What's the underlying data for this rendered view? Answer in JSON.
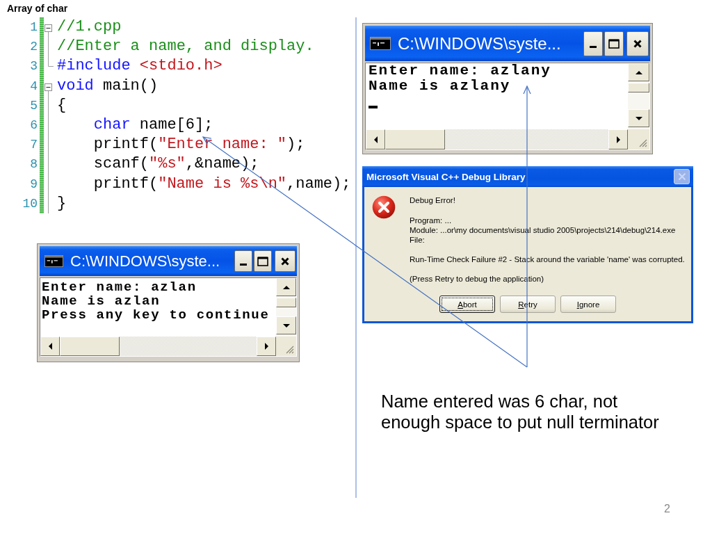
{
  "slide": {
    "title": "Array of char",
    "page_number": "2"
  },
  "left": {
    "code": {
      "lines": [
        {
          "number": "1",
          "kind": "start",
          "indented": false,
          "tokens": [
            {
              "kind": "comment",
              "text": "//1.cpp"
            }
          ]
        },
        {
          "number": "2",
          "kind": "middle",
          "indented": false,
          "tokens": [
            {
              "kind": "comment",
              "text": "//Enter a name, and display."
            }
          ]
        },
        {
          "number": "3",
          "kind": "end",
          "indented": false,
          "tokens": [
            {
              "kind": "keyword",
              "text": "#include "
            },
            {
              "kind": "string",
              "text": "<stdio.h>"
            }
          ]
        },
        {
          "number": "4",
          "kind": "start",
          "indented": false,
          "tokens": [
            {
              "kind": "keyword",
              "text": "void "
            },
            {
              "kind": "plain",
              "text": "main()"
            }
          ]
        },
        {
          "number": "5",
          "kind": "middle",
          "indented": false,
          "tokens": [
            {
              "kind": "plain",
              "text": "{"
            }
          ]
        },
        {
          "number": "6",
          "kind": "middle",
          "indented": true,
          "tokens": [
            {
              "kind": "keyword",
              "text": "char "
            },
            {
              "kind": "plain",
              "text": "name[6];"
            }
          ]
        },
        {
          "number": "7",
          "kind": "middle",
          "indented": true,
          "tokens": [
            {
              "kind": "plain",
              "text": "printf("
            },
            {
              "kind": "string",
              "text": "\"Enter name: \""
            },
            {
              "kind": "plain",
              "text": ");"
            }
          ]
        },
        {
          "number": "8",
          "kind": "middle",
          "indented": true,
          "tokens": [
            {
              "kind": "plain",
              "text": "scanf("
            },
            {
              "kind": "string",
              "text": "\"%s\""
            },
            {
              "kind": "plain",
              "text": ",&name);"
            }
          ]
        },
        {
          "number": "9",
          "kind": "middle",
          "indented": true,
          "tokens": [
            {
              "kind": "plain",
              "text": "printf("
            },
            {
              "kind": "string",
              "text": "\"Name is %s\\n\""
            },
            {
              "kind": "plain",
              "text": ",name);"
            }
          ]
        },
        {
          "number": "10",
          "kind": "middle",
          "indented": false,
          "tokens": [
            {
              "kind": "plain",
              "text": "}"
            }
          ]
        }
      ]
    },
    "console": {
      "title": "C:\\WINDOWS\\syste...",
      "output": [
        "Enter name: azlan",
        "Name is azlan",
        "Press any key to continue"
      ],
      "cursor": false
    }
  },
  "right": {
    "console": {
      "title": "C:\\WINDOWS\\syste...",
      "output": [
        "Enter name: azlany",
        "Name is azlany"
      ],
      "cursor": true
    },
    "dialog": {
      "title": "Microsoft Visual C++ Debug Library",
      "close_button": {
        "disabled": true
      },
      "heading": "Debug Error!",
      "details": [
        "Program: ...",
        "Module: ...or\\my documents\\visual studio 2005\\projects\\214\\debug\\214.exe",
        "File:"
      ],
      "message": "Run-Time Check Failure #2 - Stack around the variable 'name' was corrupted.",
      "hint": "(Press Retry to debug the application)",
      "buttons": [
        {
          "label": "Abort",
          "focused": true
        },
        {
          "label": "Retry",
          "focused": false
        },
        {
          "label": "Ignore",
          "focused": false
        }
      ]
    },
    "note": "Name entered was 6 char, not enough space to put null terminator"
  }
}
